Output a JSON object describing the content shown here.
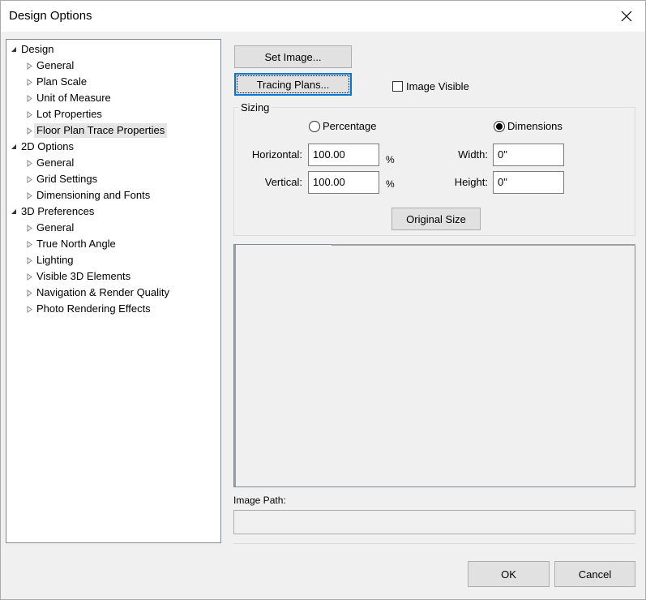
{
  "window": {
    "title": "Design Options"
  },
  "tree": {
    "items": [
      {
        "label": "Design",
        "level": 0,
        "expanded": true
      },
      {
        "label": "General",
        "level": 1
      },
      {
        "label": "Plan Scale",
        "level": 1
      },
      {
        "label": "Unit of Measure",
        "level": 1
      },
      {
        "label": "Lot Properties",
        "level": 1
      },
      {
        "label": "Floor Plan Trace Properties",
        "level": 1,
        "selected": true
      },
      {
        "label": "2D Options",
        "level": 0,
        "expanded": true
      },
      {
        "label": "General",
        "level": 1
      },
      {
        "label": "Grid Settings",
        "level": 1
      },
      {
        "label": "Dimensioning and Fonts",
        "level": 1
      },
      {
        "label": "3D Preferences",
        "level": 0,
        "expanded": true
      },
      {
        "label": "General",
        "level": 1
      },
      {
        "label": "True North Angle",
        "level": 1
      },
      {
        "label": "Lighting",
        "level": 1
      },
      {
        "label": "Visible 3D Elements",
        "level": 1
      },
      {
        "label": "Navigation & Render Quality",
        "level": 1
      },
      {
        "label": "Photo Rendering Effects",
        "level": 1
      }
    ]
  },
  "buttons": {
    "set_image": "Set Image...",
    "tracing_plans": "Tracing Plans...",
    "original_size": "Original Size",
    "ok": "OK",
    "cancel": "Cancel"
  },
  "image_visible": {
    "label": "Image Visible",
    "checked": false
  },
  "sizing": {
    "group_label": "Sizing",
    "percentage_label": "Percentage",
    "dimensions_label": "Dimensions",
    "selected": "Dimensions",
    "horizontal_label": "Horizontal:",
    "horizontal_value": "100.00",
    "vertical_label": "Vertical:",
    "vertical_value": "100.00",
    "percent_unit": "%",
    "width_label": "Width:",
    "width_value": "0\"",
    "height_label": "Height:",
    "height_value": "0\""
  },
  "image_path": {
    "label": "Image Path:",
    "value": ""
  }
}
